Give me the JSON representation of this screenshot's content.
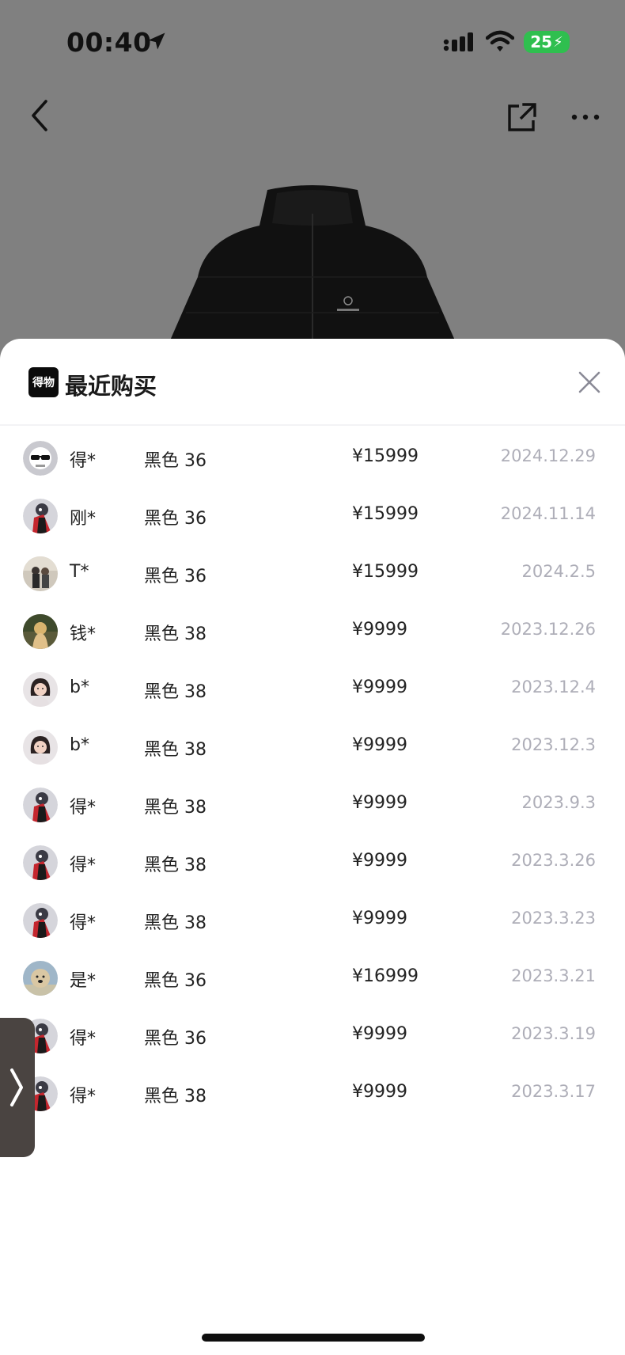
{
  "status_bar": {
    "time": "00:40",
    "battery": "25"
  },
  "sheet": {
    "brand_logo_text": "得物",
    "title": "最近购买"
  },
  "purchases": [
    {
      "name": "得*",
      "spec": "黑色 36",
      "price": "¥15999",
      "date": "2024.12.29",
      "avatar": "skull-sunglasses"
    },
    {
      "name": "刚*",
      "spec": "黑色 36",
      "price": "¥15999",
      "date": "2024.11.14",
      "avatar": "red-character"
    },
    {
      "name": "T*",
      "spec": "黑色 36",
      "price": "¥15999",
      "date": "2024.2.5",
      "avatar": "photo-people"
    },
    {
      "name": "钱*",
      "spec": "黑色 38",
      "price": "¥9999",
      "date": "2023.12.26",
      "avatar": "photo-blonde"
    },
    {
      "name": "b*",
      "spec": "黑色 38",
      "price": "¥9999",
      "date": "2023.12.4",
      "avatar": "photo-woman"
    },
    {
      "name": "b*",
      "spec": "黑色 38",
      "price": "¥9999",
      "date": "2023.12.3",
      "avatar": "photo-woman"
    },
    {
      "name": "得*",
      "spec": "黑色 38",
      "price": "¥9999",
      "date": "2023.9.3",
      "avatar": "red-character"
    },
    {
      "name": "得*",
      "spec": "黑色 38",
      "price": "¥9999",
      "date": "2023.3.26",
      "avatar": "red-character"
    },
    {
      "name": "得*",
      "spec": "黑色 38",
      "price": "¥9999",
      "date": "2023.3.23",
      "avatar": "red-character"
    },
    {
      "name": "是*",
      "spec": "黑色 36",
      "price": "¥16999",
      "date": "2023.3.21",
      "avatar": "photo-dog"
    },
    {
      "name": "得*",
      "spec": "黑色 36",
      "price": "¥9999",
      "date": "2023.3.19",
      "avatar": "red-character"
    },
    {
      "name": "得*",
      "spec": "黑色 38",
      "price": "¥9999",
      "date": "2023.3.17",
      "avatar": "red-character"
    }
  ],
  "colors": {
    "date_text": "#aeaeb8",
    "background_overlay": "#808080",
    "brand_black": "#0b0b0b"
  }
}
